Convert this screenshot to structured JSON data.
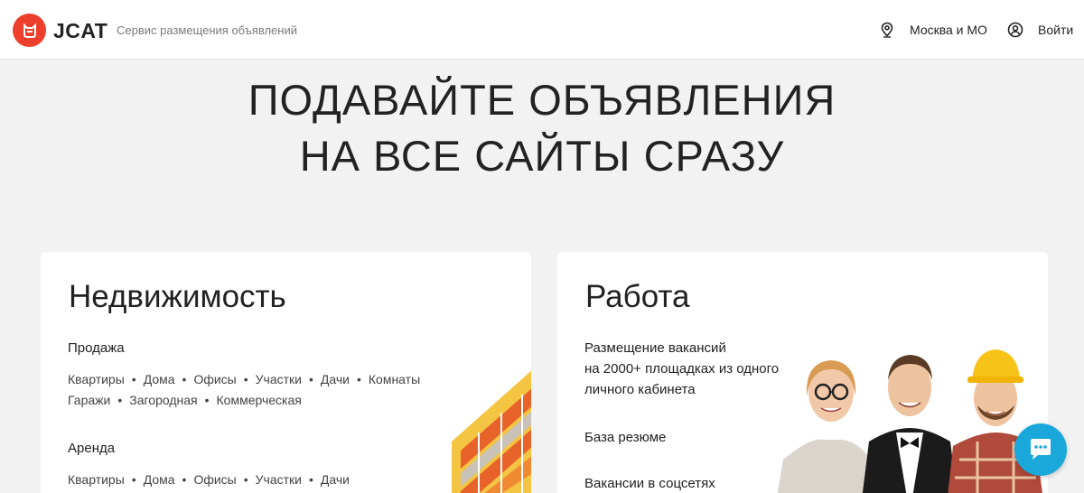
{
  "header": {
    "logo_text": "JCAT",
    "tagline": "Сервис размещения объявлений",
    "location": "Москва и МО",
    "login": "Войти"
  },
  "hero": {
    "line1": "ПОДАВАЙТЕ ОБЪЯВЛЕНИЯ",
    "line2": "НА ВСЕ САЙТЫ СРАЗУ"
  },
  "realty": {
    "title": "Недвижимость",
    "sale_title": "Продажа",
    "sale_links_row1": [
      "Квартиры",
      "Дома",
      "Офисы",
      "Участки",
      "Дачи",
      "Комнаты"
    ],
    "sale_links_row2": [
      "Гаражи",
      "Загородная",
      "Коммерческая"
    ],
    "rent_title": "Аренда",
    "rent_links": [
      "Квартиры",
      "Дома",
      "Офисы",
      "Участки",
      "Дачи"
    ]
  },
  "jobs": {
    "title": "Работа",
    "line1": "Размещение вакансий",
    "line2": "на 2000+ площадках из одного",
    "line3": "личного кабинета",
    "resume": "База резюме",
    "social": "Вакансии в соцсетях"
  },
  "colors": {
    "brand": "#ee3f2c",
    "chat": "#1aa7d9",
    "background": "#f2f2f2"
  }
}
